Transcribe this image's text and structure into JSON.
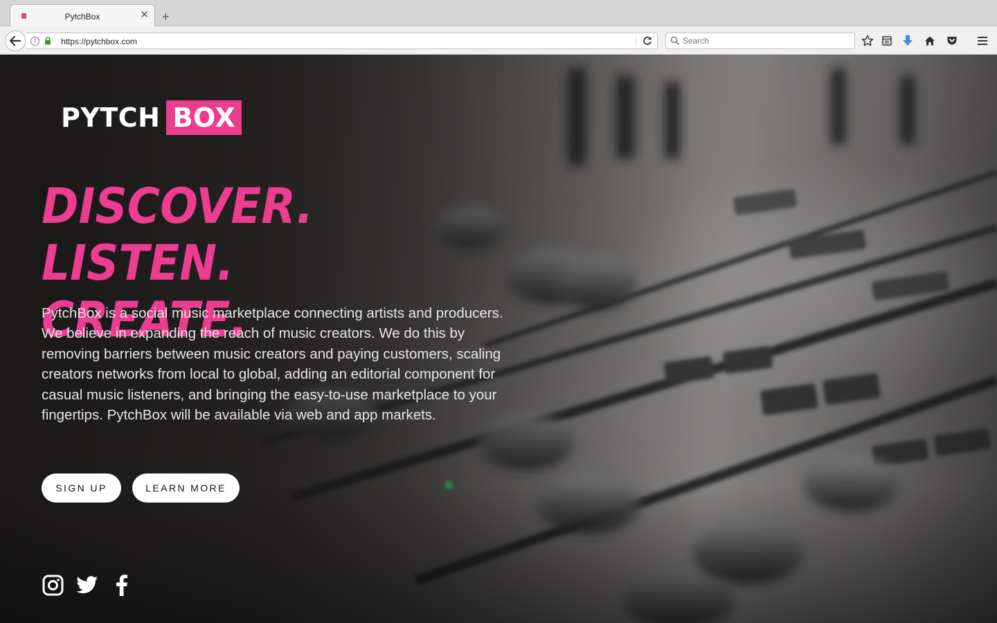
{
  "browser": {
    "tab_title": "PytchBox",
    "tab_close_glyph": "✕",
    "new_tab_glyph": "+",
    "url": "https://pytchbox.com",
    "search_placeholder": "Search",
    "favicon_color": "#ec3d91",
    "toolbar_icons": [
      "bookmark-star-icon",
      "reading-list-icon",
      "downloads-icon",
      "home-icon",
      "pocket-icon",
      "hamburger-menu-icon"
    ]
  },
  "page": {
    "logo": {
      "part1": "PYTCH",
      "part2": "BOX"
    },
    "headline": {
      "line1": "DISCOVER. LISTEN.",
      "line2": "CREATE."
    },
    "description": "PytchBox is a social music marketplace connecting artists and producers. We believe in expanding the reach of music creators. We do this by removing barriers between music creators and paying customers, scaling creators networks from local to global, adding an editorial component for casual music listeners, and bringing the easy-to-use marketplace to your fingertips. PytchBox will be available via web and app markets.",
    "buttons": {
      "signup": "SIGN UP",
      "learn_more": "LEARN MORE"
    },
    "social_icons": [
      "instagram-icon",
      "twitter-icon",
      "facebook-icon"
    ],
    "accent_color": "#ec3d91"
  }
}
